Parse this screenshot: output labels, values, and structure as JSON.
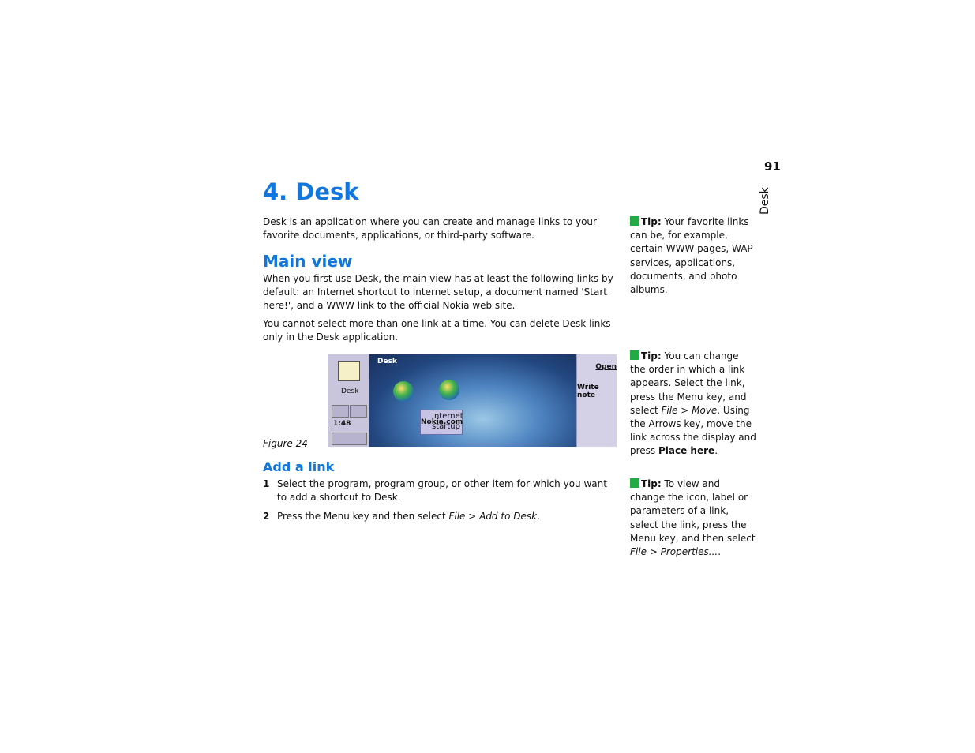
{
  "page": {
    "number": "91",
    "side_label": "Desk"
  },
  "chapter": {
    "title": "4. Desk",
    "intro": "Desk is an application where you can create and manage links to your favorite documents, applications, or third-party software."
  },
  "main_view": {
    "heading": "Main view",
    "p1": "When you first use Desk, the main view has at least the following links by default: an Internet shortcut to Internet setup, a document named 'Start here!', and a WWW link to the official Nokia web site.",
    "p2": "You cannot select more than one link at a time. You can delete Desk links only in the Desk application."
  },
  "figure": {
    "caption": "Figure 24",
    "app_title": "Desk",
    "left_label": "Desk",
    "clock": "1:48",
    "links": [
      "Nokia.com",
      "Internet startup"
    ],
    "soft_buttons": [
      "Open",
      "Write note"
    ]
  },
  "add_link": {
    "heading": "Add a link",
    "steps": [
      {
        "num": "1",
        "text": "Select the program, program group, or other item for which you want to add a shortcut to Desk."
      },
      {
        "num": "2",
        "text_before": "Press the Menu key and then select ",
        "em1": "File",
        "sep": " > ",
        "em2": "Add to Desk",
        "text_after": "."
      }
    ]
  },
  "tips": [
    {
      "label": "Tip:",
      "text": " Your favorite links can be, for example, certain WWW pages, WAP services, applications, documents, and photo albums."
    },
    {
      "label": "Tip:",
      "text_before": " You can change the order in which a link appears. Select the link, press the Menu key, and select ",
      "em1": "File",
      "sep": " > ",
      "em2": "Move",
      "text_mid": ". Using the Arrows key, move the link across the display and press ",
      "bold": "Place here",
      "text_after": "."
    },
    {
      "label": "Tip:",
      "text_before": " To view and change the icon, label or parameters of a link, select the link, press the Menu key, and then select ",
      "em1": "File",
      "sep": " > ",
      "em2": "Properties...",
      "text_after": "."
    }
  ],
  "colors": {
    "heading": "#1177dd",
    "tip_square": "#22aa44"
  }
}
